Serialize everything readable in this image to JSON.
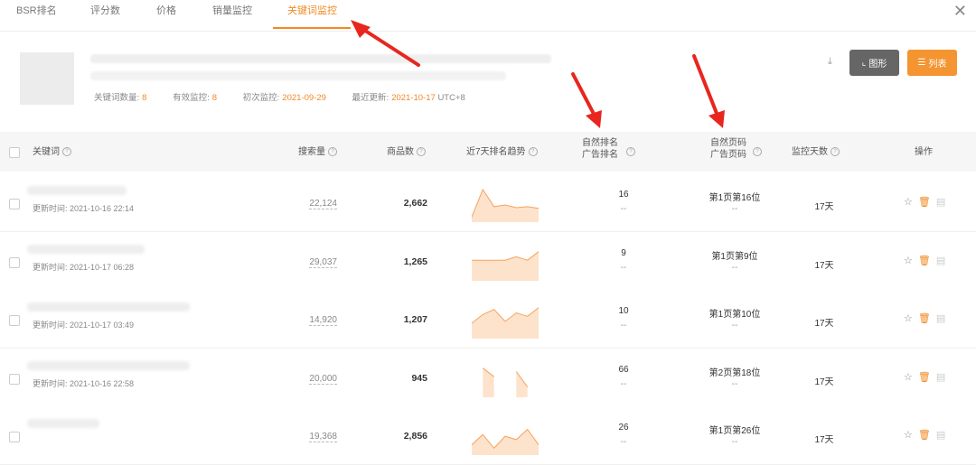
{
  "tabs": [
    {
      "label": "BSR排名"
    },
    {
      "label": "评分数"
    },
    {
      "label": "价格"
    },
    {
      "label": "销量监控"
    },
    {
      "label": "关键词监控"
    }
  ],
  "close_icon": "close-icon",
  "summary": {
    "keyword_count_label": "关键词数量:",
    "keyword_count": "8",
    "valid_monitor_label": "有效监控:",
    "valid_monitor": "8",
    "first_monitor_label": "初次监控:",
    "first_monitor": "2021-09-29",
    "last_update_label": "最近更新:",
    "last_update": "2021-10-17",
    "timezone": "UTC+8"
  },
  "toolbar": {
    "chart_label": "图形",
    "list_label": "列表",
    "chart_icon": "chart-icon",
    "list_icon": "list-icon"
  },
  "header": {
    "keyword": "关键词",
    "search_volume": "搜索量",
    "product_count": "商品数",
    "trend": "近7天排名趋势",
    "natural_rank": "自然排名",
    "ad_rank": "广告排名",
    "natural_page": "自然页码",
    "ad_page": "广告页码",
    "monitor_days": "监控天数",
    "actions": "操作"
  },
  "rows": [
    {
      "updated": "更新时间: 2021-10-16 22:14",
      "search_volume": "22,124",
      "product_count": "2,662",
      "natural_rank": "16",
      "ad_rank": "--",
      "natural_page": "第1页第16位",
      "ad_page": "--",
      "days": "17天",
      "trend": [
        0.15,
        0.95,
        0.45,
        0.5,
        0.42,
        0.45,
        0.4
      ]
    },
    {
      "updated": "更新时间: 2021-10-17 06:28",
      "search_volume": "29,037",
      "product_count": "1,265",
      "natural_rank": "9",
      "ad_rank": "--",
      "natural_page": "第1页第9位",
      "ad_page": "--",
      "days": "17天",
      "trend": [
        0.6,
        0.6,
        0.6,
        0.6,
        0.7,
        0.6,
        0.85
      ]
    },
    {
      "updated": "更新时间: 2021-10-17 03:49",
      "search_volume": "14,920",
      "product_count": "1,207",
      "natural_rank": "10",
      "ad_rank": "--",
      "natural_page": "第1页第10位",
      "ad_page": "--",
      "days": "17天",
      "trend": [
        0.45,
        0.7,
        0.85,
        0.5,
        0.75,
        0.65,
        0.9
      ]
    },
    {
      "updated": "更新时间: 2021-10-16 22:58",
      "search_volume": "20,000",
      "product_count": "945",
      "natural_rank": "66",
      "ad_rank": "--",
      "natural_page": "第2页第18位",
      "ad_page": "--",
      "days": "17天",
      "trend": [
        null,
        0.85,
        0.6,
        null,
        0.75,
        0.3,
        null
      ]
    },
    {
      "updated": "",
      "search_volume": "19,368",
      "product_count": "2,856",
      "natural_rank": "26",
      "ad_rank": "--",
      "natural_page": "第1页第26位",
      "ad_page": "--",
      "days": "17天",
      "trend": [
        0.3,
        0.6,
        0.2,
        0.55,
        0.45,
        0.75,
        0.3
      ]
    }
  ],
  "colors": {
    "accent": "#f08a24",
    "spark_fill": "#fde3cc",
    "spark_line": "#f5a25d",
    "arrow": "#e8261e"
  }
}
